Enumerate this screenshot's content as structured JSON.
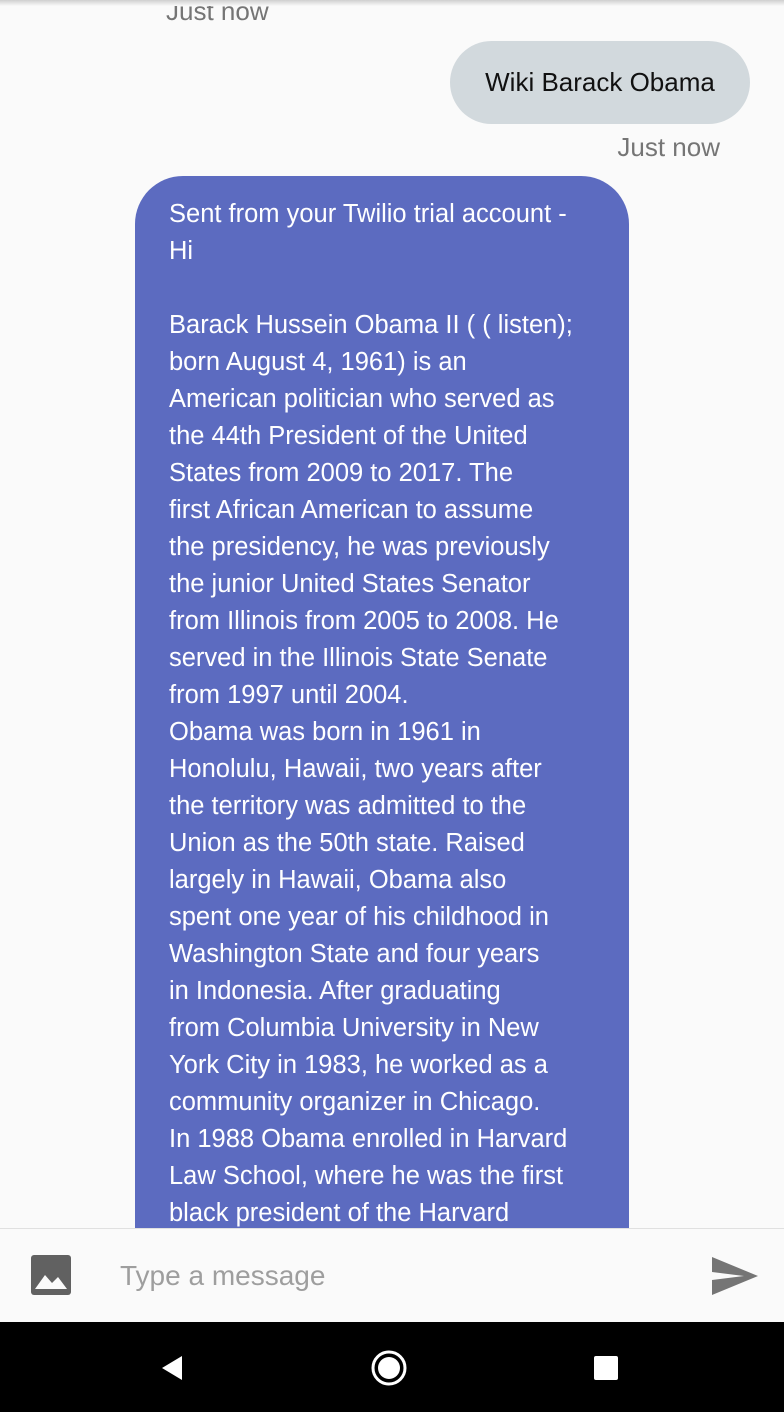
{
  "messages": {
    "top_timestamp": "Just now",
    "outgoing": {
      "text": "Wiki Barack Obama",
      "timestamp": "Just now"
    },
    "incoming": {
      "text": "Sent from your Twilio trial account -\nHi\n\nBarack Hussein Obama II ( ( listen);\nborn August 4, 1961) is an\nAmerican politician who served as\nthe 44th President of the United\nStates from 2009 to 2017. The\nfirst African American to assume\nthe presidency, he was previously\nthe junior United States Senator\nfrom Illinois from 2005 to 2008. He\nserved in the Illinois State Senate\nfrom 1997 until 2004.\nObama was born in 1961 in\nHonolulu, Hawaii, two years after\nthe territory was admitted to the\nUnion as the 50th state. Raised\nlargely in Hawaii, Obama also\nspent one year of his childhood in\nWashington State and four years\nin Indonesia. After graduating\nfrom Columbia University in New\nYork City in 1983, he worked as a\ncommunity organizer in Chicago.\nIn 1988 Obama enrolled in Harvard\nLaw School, where he was the first\nblack president of the Harvard"
    }
  },
  "composer": {
    "placeholder": "Type a message",
    "value": "",
    "attach_icon": "image-icon",
    "send_icon": "send-icon"
  },
  "navbar": {
    "back_icon": "back-triangle-icon",
    "home_icon": "home-circle-icon",
    "recents_icon": "recents-square-icon"
  },
  "colors": {
    "background": "#fafafa",
    "incoming_bubble": "#5c6bc0",
    "outgoing_bubble": "#d2d9dd",
    "timestamp": "#757575",
    "icon": "#616161",
    "navbar": "#000000"
  }
}
